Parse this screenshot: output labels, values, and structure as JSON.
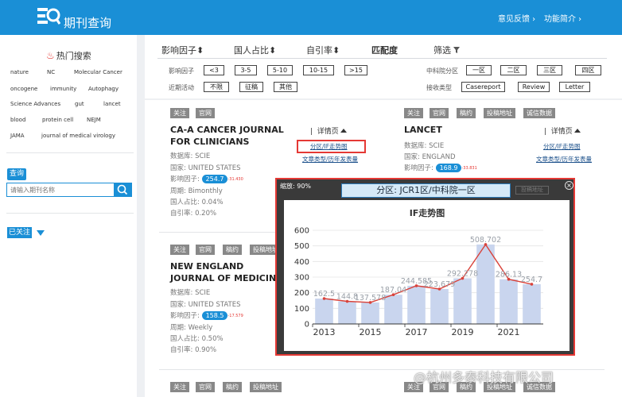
{
  "app": {
    "brand": "期刊查询",
    "links": [
      "意见反馈 ›",
      "功能简介 ›"
    ]
  },
  "sidebar": {
    "hot_title": "热门搜索",
    "tags": [
      "nature",
      "NC",
      "Molecular Cancer",
      "oncogene",
      "immunity",
      "Autophagy",
      "Science Advances",
      "gut",
      "lancet",
      "blood",
      "protein cell",
      "NEJM",
      "JAMA",
      "journal of medical virology"
    ],
    "search_label": "查询",
    "search_placeholder": "请输入期刊名称",
    "follow_label": "已关注"
  },
  "sort": {
    "tabs": [
      "影响因子⬍",
      "国人占比⬍",
      "自引率⬍",
      "匹配度",
      "筛选"
    ]
  },
  "filters": {
    "if_label": "影响因子",
    "if_options": [
      "<3",
      "3-5",
      "5-10",
      "10-15",
      ">15"
    ],
    "activity_label": "近期活动",
    "activity_options": [
      "不限",
      "征稿",
      "其他"
    ],
    "zone_label": "中科院分区",
    "zone_options": [
      "一区",
      "二区",
      "三区",
      "四区"
    ],
    "type_label": "接收类型",
    "type_options": [
      "Casereport",
      "Review",
      "Letter"
    ]
  },
  "journals": [
    {
      "tags": [
        "关注",
        "官网"
      ],
      "title": "CA-A CANCER JOURNAL FOR CLINICIANS",
      "database": "数据库: SCIE",
      "country": "国家: UNITED STATES",
      "if_label": "影响因子:",
      "if_value": "254.7",
      "if_delta": "-31.430",
      "cycle": "周期: Bimonthly",
      "chinese_ratio": "国人占比: 0.04%",
      "self_cite": "自引率: 0.20%",
      "detail": "详情页",
      "link1": "分区/IF走势图",
      "link2": "文章类型/历年发表量"
    },
    {
      "tags": [
        "关注",
        "官网",
        "稿约",
        "投稿地址",
        "诚信数据"
      ],
      "title": "LANCET",
      "database": "数据库: SCIE",
      "country": "国家: ENGLAND",
      "if_label": "影响因子:",
      "if_value": "168.9",
      "if_delta": "-33.831",
      "detail": "详情页",
      "link1": "分区/IF走势图",
      "link2": "文章类型/历年发表量"
    },
    {
      "tags": [
        "关注",
        "官网",
        "稿约",
        "投稿地址"
      ],
      "title": "NEW ENGLAND JOURNAL OF MEDICINE",
      "database": "数据库: SCIE",
      "country": "国家: UNITED STATES",
      "if_label": "影响因子:",
      "if_value": "158.5",
      "if_delta": "-17.579",
      "cycle": "周期: Weekly",
      "chinese_ratio": "国人占比: 0.50%",
      "self_cite": "自引率: 0.90%"
    },
    {
      "tags": [
        "关注",
        "官网",
        "稿约",
        "投稿地址"
      ]
    },
    {
      "tags": [
        "关注",
        "官网",
        "稿约",
        "投稿地址",
        "诚信数据"
      ]
    }
  ],
  "popup": {
    "zoom": "缩放: 90%",
    "title": "分区: JCR1区/中科院一区",
    "ghost_button": "投稿地址",
    "close": "×"
  },
  "chart_data": {
    "type": "bar",
    "title": "IF走势图",
    "categories": [
      "2013",
      "2014",
      "2015",
      "2016",
      "2017",
      "2018",
      "2019",
      "2020",
      "2021",
      "2022"
    ],
    "values": [
      162.5,
      144.8,
      137.578,
      187.04,
      244.585,
      223.679,
      292.278,
      508.702,
      286.13,
      254.7
    ],
    "data_labels": [
      "162.5",
      "144.8",
      "137.578",
      "187.04",
      "244.585",
      "223.679",
      "292.278",
      "508.702",
      "286.13",
      "254.7"
    ],
    "x_tick_labels": [
      "2013",
      "2015",
      "2017",
      "2019",
      "2021"
    ],
    "y_ticks": [
      0,
      100,
      200,
      300,
      400,
      500,
      600
    ],
    "ylim": [
      0,
      600
    ],
    "bar_color": "#c9d5ee",
    "line_color": "#d9423a",
    "grid": true
  },
  "watermark": "@杭州多泰科技有限公司"
}
